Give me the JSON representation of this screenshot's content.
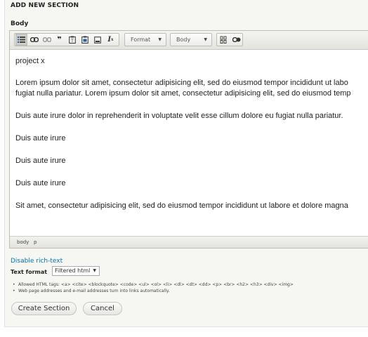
{
  "section_title": "ADD NEW SECTION",
  "body_label": "Body",
  "toolbar": {
    "group1_icons": [
      "bulleted-list-icon",
      "link-icon",
      "unlink-icon",
      "blockquote-icon",
      "paste-text-icon",
      "paste-word-icon",
      "template-icon",
      "remove-format-icon"
    ],
    "format_combo": "Format",
    "style_combo": "Body",
    "group2_icons": [
      "source-icon",
      "show-blocks-icon"
    ]
  },
  "editor": {
    "paragraphs": [
      "project x",
      "Lorem ipsum dolor sit amet, consectetur adipisicing elit, sed do eiusmod tempor incididunt ut labo",
      "fugiat nulla pariatur. Lorem ipsum dolor sit amet, consectetur adipisicing elit, sed do eiusmod temp",
      "Duis aute irure dolor in reprehenderit in voluptate velit esse cillum dolore eu fugiat nulla pariatur.",
      "Duis aute irure",
      "Duis aute irure",
      "Duis aute irure",
      "Sit amet, consectetur adipisicing elit, sed do eiusmod tempor incididunt ut labore et dolore magna"
    ],
    "path": [
      "body",
      "p"
    ]
  },
  "disable_rich_text": "Disable rich-text",
  "text_format": {
    "label": "Text format",
    "selected": "Filtered html"
  },
  "tips": [
    "Allowed HTML tags: <a> <cite> <blockquote> <code> <ul> <ol> <li> <dl> <dt> <dd> <p> <br> <h2> <h3> <div> <img>",
    "Web page addresses and e-mail addresses turn into links automatically."
  ],
  "buttons": {
    "create": "Create Section",
    "cancel": "Cancel"
  }
}
